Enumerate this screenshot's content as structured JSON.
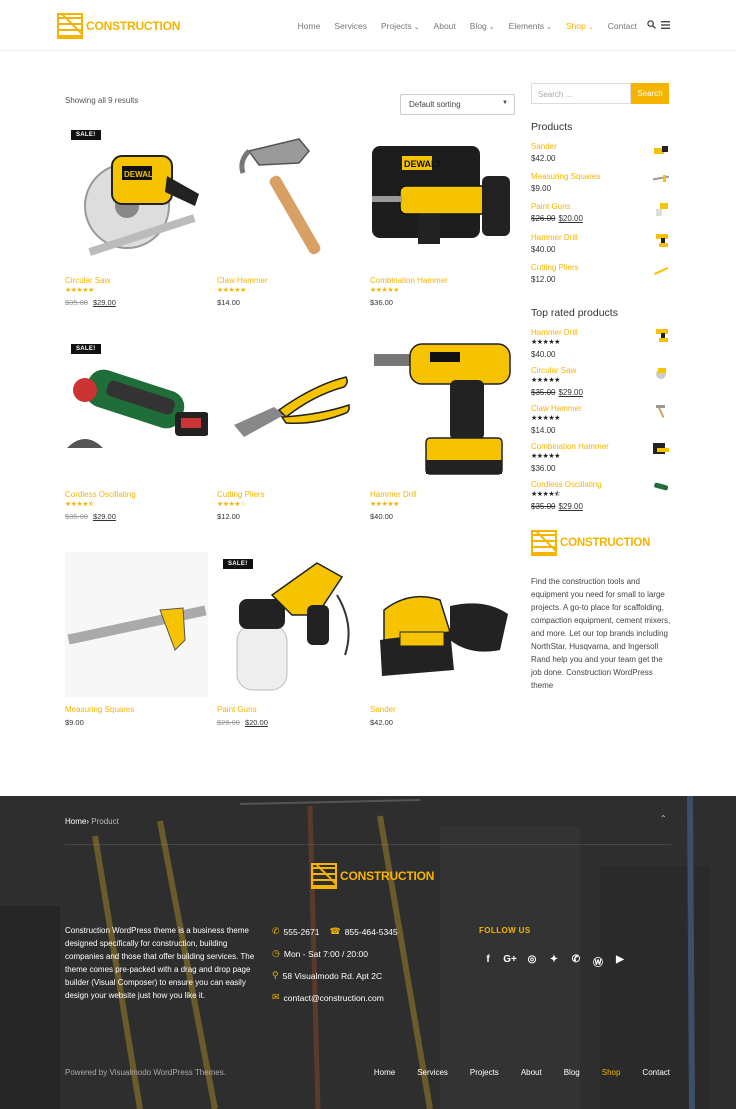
{
  "brand": {
    "name": "CONSTRUCTION",
    "accent": "#f5b400"
  },
  "nav": {
    "items": [
      {
        "label": "Home",
        "caret": false
      },
      {
        "label": "Services",
        "caret": false
      },
      {
        "label": "Projects",
        "caret": true
      },
      {
        "label": "About",
        "caret": false
      },
      {
        "label": "Blog",
        "caret": true
      },
      {
        "label": "Elements",
        "caret": true
      },
      {
        "label": "Shop",
        "caret": true,
        "active": true
      },
      {
        "label": "Contact",
        "caret": false
      }
    ],
    "search_icon": "search-icon",
    "menu_icon": "hamburger-icon"
  },
  "shop": {
    "result_count": "Showing all 9 results",
    "sorting": "Default sorting",
    "sale_badge": "SALE!",
    "products": [
      {
        "name": "Circular Saw",
        "rating": 5,
        "old_price": "$35.00",
        "price": "$29.00",
        "sale": true
      },
      {
        "name": "Claw Hammer",
        "rating": 5,
        "price": "$14.00",
        "sale": false
      },
      {
        "name": "Combination Hammer",
        "rating": 5,
        "price": "$36.00",
        "sale": false
      },
      {
        "name": "Cordless Oscillating",
        "rating": 4.5,
        "old_price": "$35.00",
        "price": "$29.00",
        "sale": true
      },
      {
        "name": "Cutting Pliers",
        "rating": 4,
        "price": "$12.00",
        "sale": false
      },
      {
        "name": "Hammer Drill",
        "rating": 5,
        "price": "$40.00",
        "sale": false
      },
      {
        "name": "Measuring Squares",
        "rating": 0,
        "price": "$9.00",
        "sale": false
      },
      {
        "name": "Paint Guns",
        "rating": 0,
        "old_price": "$26.00",
        "price": "$20.00",
        "sale": true
      },
      {
        "name": "Sander",
        "rating": 0,
        "price": "$42.00",
        "sale": false
      }
    ]
  },
  "sidebar": {
    "search_placeholder": "Search ...",
    "search_button": "Search",
    "products_title": "Products",
    "products": [
      {
        "name": "Sander",
        "price": "$42.00"
      },
      {
        "name": "Measuring Squares",
        "price": "$9.00"
      },
      {
        "name": "Paint Guns",
        "old_price": "$26.00",
        "price": "$20.00"
      },
      {
        "name": "Hammer Drill",
        "price": "$40.00"
      },
      {
        "name": "Cutting Pliers",
        "price": "$12.00"
      }
    ],
    "top_rated_title": "Top rated products",
    "top_rated": [
      {
        "name": "Hammer Drill",
        "rating": 5,
        "price": "$40.00"
      },
      {
        "name": "Circular Saw",
        "rating": 5,
        "old_price": "$35.00",
        "price": "$29.00"
      },
      {
        "name": "Claw Hammer",
        "rating": 5,
        "price": "$14.00"
      },
      {
        "name": "Combination Hammer",
        "rating": 5,
        "price": "$36.00"
      },
      {
        "name": "Cordless Oscillating",
        "rating": 4.5,
        "old_price": "$35.00",
        "price": "$29.00"
      }
    ],
    "about_text": "Find the construction tools and equipment you need for small to large projects. A go-to place for scaffolding, compaction equipment, cement mixers, and more. Let our top brands including NorthStar, Husqvarna, and Ingersoll Rand help you and your team get the job done. Construction WordPress theme"
  },
  "footer": {
    "breadcrumb_home": "Home",
    "breadcrumb_sep": "›",
    "breadcrumb_current": "Product",
    "about": "Construction WordPress theme is a business theme designed specifically for construction, building companies and those that offer building services. The theme comes pre-packed with a drag and drop page builder (Visual Composer) to ensure you can easily design your website just how you like it.",
    "phone1": "555-2671",
    "phone2": "855-464-5345",
    "hours": "Mon - Sat 7:00 / 20:00",
    "address": "58 Visualmodo Rd. Apt 2C",
    "email": "contact@construction.com",
    "follow_title": "FOLLOW US",
    "social": [
      {
        "icon": "facebook-icon",
        "glyph": "f"
      },
      {
        "icon": "google-plus-icon",
        "glyph": "G+"
      },
      {
        "icon": "instagram-icon",
        "glyph": "◎"
      },
      {
        "icon": "twitter-icon",
        "glyph": "✦"
      },
      {
        "icon": "whatsapp-icon",
        "glyph": "✆"
      },
      {
        "icon": "wordpress-icon",
        "glyph": "Ⓦ"
      },
      {
        "icon": "youtube-icon",
        "glyph": "▶"
      }
    ],
    "powered": "Powered by Visualmodo WordPress Themes.",
    "nav": [
      {
        "label": "Home"
      },
      {
        "label": "Services"
      },
      {
        "label": "Projects"
      },
      {
        "label": "About"
      },
      {
        "label": "Blog"
      },
      {
        "label": "Shop",
        "active": true
      },
      {
        "label": "Contact"
      }
    ]
  }
}
